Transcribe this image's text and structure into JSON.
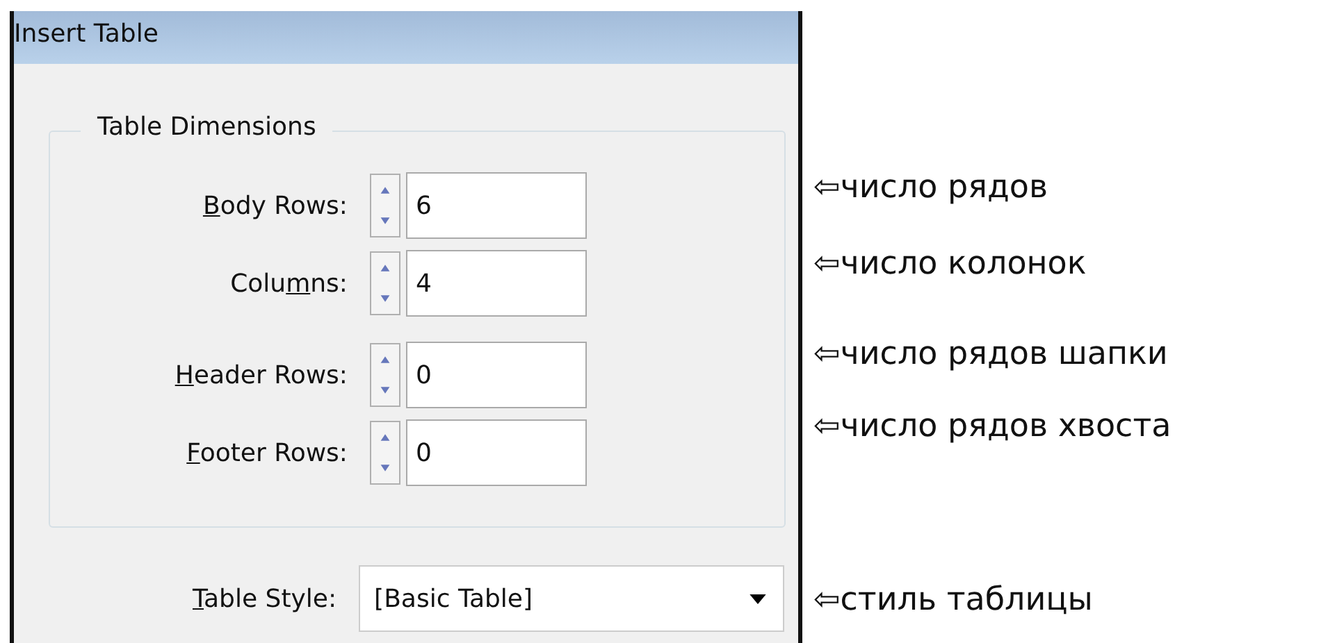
{
  "window": {
    "title": "Insert Table"
  },
  "group": {
    "title": "Table Dimensions"
  },
  "fields": [
    {
      "label": {
        "key": "B",
        "after": "ody Rows:"
      },
      "value": "6"
    },
    {
      "label": {
        "before": "Colu",
        "key": "m",
        "after": "ns:"
      },
      "value": "4"
    },
    {
      "label": {
        "key": "H",
        "after": "eader Rows:"
      },
      "value": "0"
    },
    {
      "label": {
        "key": "F",
        "after": "ooter Rows:"
      },
      "value": "0"
    }
  ],
  "table_style": {
    "label": {
      "key": "T",
      "after": "able Style:"
    },
    "value": "[Basic Table]"
  },
  "annotations": [
    "⇦число рядов",
    "⇦число колонок",
    "⇦число рядов шапки",
    "⇦число рядов хвоста",
    "⇦стиль таблицы"
  ]
}
